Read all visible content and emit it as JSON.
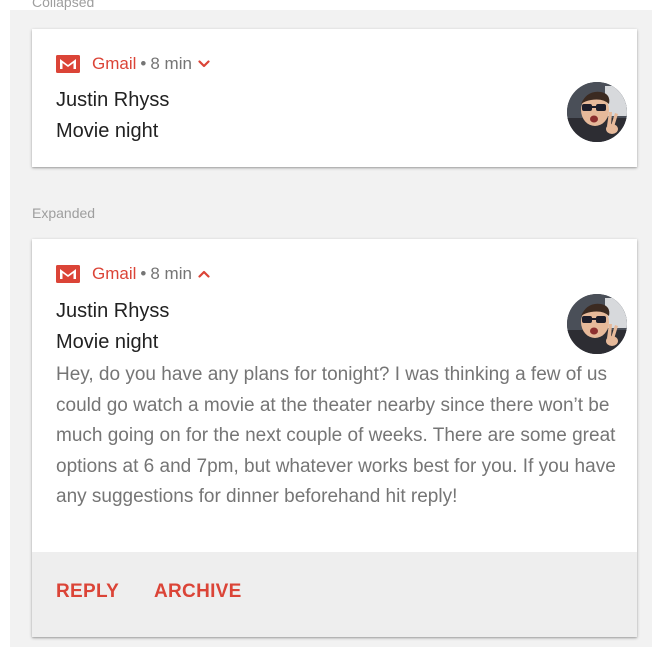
{
  "labels": {
    "collapsed": "Collapsed",
    "expanded": "Expanded"
  },
  "notification": {
    "app_name": "Gmail",
    "separator": "•",
    "time": "8 min",
    "sender": "Justin Rhyss",
    "subject": "Movie night",
    "body": "Hey, do you have any plans for tonight? I was thinking a few of us could go watch a movie at the theater nearby since there won’t be much going on for the next couple of weeks. There are some great options at 6 and 7pm, but whatever works best for you. If you have any suggestions for dinner beforehand hit reply!",
    "collapsed_chevron_icon": "chevron-down-icon",
    "expanded_chevron_icon": "chevron-up-icon",
    "app_icon": "gmail-icon"
  },
  "actions": {
    "reply_label": "REPLY",
    "archive_label": "ARCHIVE"
  },
  "colors": {
    "accent": "#db4437",
    "secondary_text": "#757575",
    "primary_text": "#212121",
    "background": "#f2f2f2",
    "action_bar": "#eeeeee"
  }
}
